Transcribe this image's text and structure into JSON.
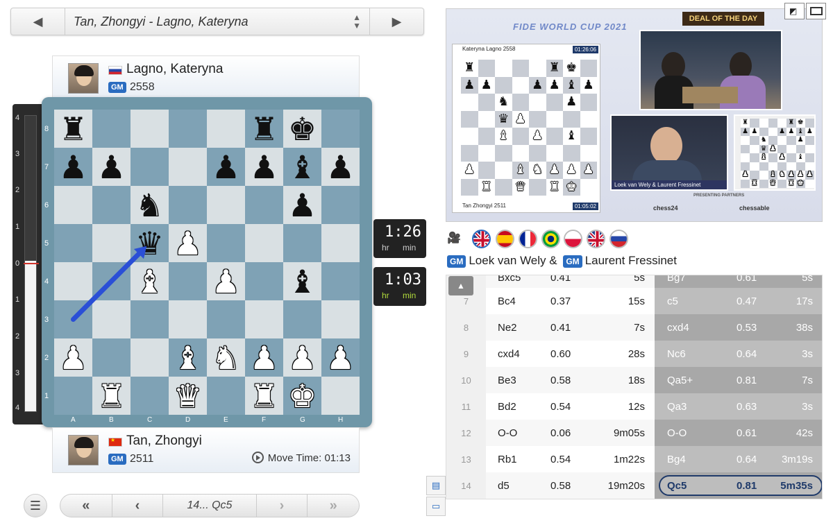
{
  "game_selector": {
    "title": "Tan, Zhongyi - Lagno, Kateryna"
  },
  "top_player": {
    "name": "Lagno, Kateryna",
    "title": "GM",
    "rating": "2558",
    "flag": "russia-flag"
  },
  "bottom_player": {
    "name": "Tan, Zhongyi",
    "title": "GM",
    "rating": "2511",
    "flag": "china-flag",
    "move_time_label": "Move Time: 01:13"
  },
  "clocks": {
    "top": {
      "time": "1:26",
      "hr": "hr",
      "min": "min"
    },
    "bottom": {
      "time": "1:03",
      "hr": "hr",
      "min": "min"
    }
  },
  "eval_bar": {
    "ticks_top": [
      "4",
      "3",
      "2",
      "1"
    ],
    "zero": "0",
    "ticks_bottom": [
      "1",
      "2",
      "3",
      "4"
    ],
    "white_share": 0.51
  },
  "board": {
    "files": [
      "A",
      "B",
      "C",
      "D",
      "E",
      "F",
      "G",
      "H"
    ],
    "ranks": [
      "8",
      "7",
      "6",
      "5",
      "4",
      "3",
      "2",
      "1"
    ],
    "position": [
      [
        "bR",
        "",
        "",
        "",
        "",
        "bR",
        "bK",
        ""
      ],
      [
        "bP",
        "bP",
        "",
        "",
        "bP",
        "bP",
        "bB",
        "bP"
      ],
      [
        "",
        "",
        "bN",
        "",
        "",
        "",
        "bP",
        ""
      ],
      [
        "",
        "",
        "bQ",
        "wP",
        "",
        "",
        "",
        ""
      ],
      [
        "",
        "",
        "wB",
        "",
        "wP",
        "",
        "bB",
        ""
      ],
      [
        "",
        "",
        "",
        "",
        "",
        "",
        "",
        ""
      ],
      [
        "wP",
        "",
        "",
        "wB",
        "wN",
        "wP",
        "wP",
        "wP"
      ],
      [
        "",
        "wR",
        "",
        "wQ",
        "",
        "wR",
        "wK",
        ""
      ]
    ],
    "last_move_arrow": {
      "from": "a3",
      "to": "c5",
      "color": "#2a4fd6"
    }
  },
  "move_nav": {
    "current": "14... Qc5",
    "first": "«",
    "prev": "‹",
    "next": "›",
    "last": "»"
  },
  "broadcast": {
    "event": "FIDE WORLD CUP 2021",
    "deal": "DEAL OF THE DAY",
    "overlay_top_player": "Kateryna Lagno 2558",
    "overlay_top_clock": "01:26:06",
    "overlay_bottom_player": "Tan Zhongyi 2511",
    "overlay_bottom_clock": "01:05:02",
    "cam_label": "Loek van Wely & Laurent Fressinet",
    "sponsor1": "chess24",
    "sponsor2": "chessable",
    "presenting": "PRESENTING PARTNERS"
  },
  "commentary": {
    "languages": [
      "uk-flag",
      "spain-flag",
      "france-flag",
      "brazil-flag",
      "poland-flag",
      "uk-flag",
      "russia-flag"
    ],
    "commentator1": "Loek van Wely &",
    "commentator2": "Laurent Fressinet",
    "title": "GM"
  },
  "moves": [
    {
      "n": "",
      "w": "Bxc5",
      "we": "0.41",
      "wt": "5s",
      "b": "Bg7",
      "be": "0.61",
      "bt": "5s"
    },
    {
      "n": "7",
      "w": "Bc4",
      "we": "0.37",
      "wt": "15s",
      "b": "c5",
      "be": "0.47",
      "bt": "17s"
    },
    {
      "n": "8",
      "w": "Ne2",
      "we": "0.41",
      "wt": "7s",
      "b": "cxd4",
      "be": "0.53",
      "bt": "38s"
    },
    {
      "n": "9",
      "w": "cxd4",
      "we": "0.60",
      "wt": "28s",
      "b": "Nc6",
      "be": "0.64",
      "bt": "3s"
    },
    {
      "n": "10",
      "w": "Be3",
      "we": "0.58",
      "wt": "18s",
      "b": "Qa5+",
      "be": "0.81",
      "bt": "7s"
    },
    {
      "n": "11",
      "w": "Bd2",
      "we": "0.54",
      "wt": "12s",
      "b": "Qa3",
      "be": "0.63",
      "bt": "3s"
    },
    {
      "n": "12",
      "w": "O-O",
      "we": "0.06",
      "wt": "9m05s",
      "b": "O-O",
      "be": "0.61",
      "bt": "42s"
    },
    {
      "n": "13",
      "w": "Rb1",
      "we": "0.54",
      "wt": "1m22s",
      "b": "Bg4",
      "be": "0.64",
      "bt": "3m19s"
    },
    {
      "n": "14",
      "w": "d5",
      "we": "0.58",
      "wt": "19m20s",
      "b": "Qc5",
      "be": "0.81",
      "bt": "5m35s"
    }
  ]
}
